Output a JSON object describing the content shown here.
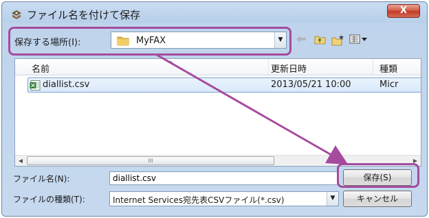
{
  "window": {
    "title": "ファイル名を付けて保存",
    "close_glyph": "X"
  },
  "toolbar": {
    "save_in_label": "保存する場所(I):",
    "save_in_value": "MyFAX",
    "icons": [
      "back-icon",
      "up-folder-icon",
      "new-folder-icon",
      "view-menu-icon"
    ]
  },
  "filelist": {
    "columns": [
      "名前",
      "更新日時",
      "種類"
    ],
    "rows": [
      {
        "name": "diallist.csv",
        "modified": "2013/05/21 10:00",
        "type": "Micr"
      }
    ],
    "scroll_thumb_grip": "III"
  },
  "form": {
    "filename_label": "ファイル名(N):",
    "filename_value": "diallist.csv",
    "filetype_label": "ファイルの種類(T):",
    "filetype_value": "Internet Services宛先表CSVファイル(*.csv)"
  },
  "buttons": {
    "save": "保存(S)",
    "cancel": "キャンセル"
  },
  "colors": {
    "annotation": "#a54b9e",
    "title_bar": "#b8cfea",
    "selection": "#d9e9fa"
  }
}
